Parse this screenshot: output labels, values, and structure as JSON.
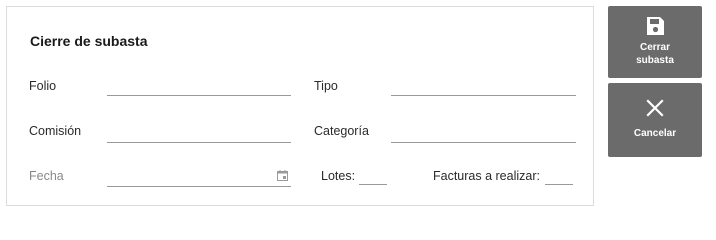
{
  "form": {
    "title": "Cierre de subasta",
    "fields": {
      "folio": {
        "label": "Folio",
        "value": ""
      },
      "tipo": {
        "label": "Tipo",
        "value": ""
      },
      "comision": {
        "label": "Comisión",
        "value": ""
      },
      "categoria": {
        "label": "Categoría",
        "value": ""
      },
      "fecha": {
        "label": "Fecha",
        "value": ""
      },
      "lotes": {
        "label": "Lotes:",
        "value": ""
      },
      "facturas": {
        "label": "Facturas a realizar:",
        "value": ""
      }
    }
  },
  "actions": {
    "cerrar": {
      "label": "Cerrar\nsubasta",
      "icon": "save-icon"
    },
    "cancelar": {
      "label": "Cancelar",
      "icon": "close-icon"
    }
  },
  "colors": {
    "button_bg": "#6b6b6b",
    "underline": "#9a9a9a",
    "muted_label": "#8a8a8a"
  }
}
